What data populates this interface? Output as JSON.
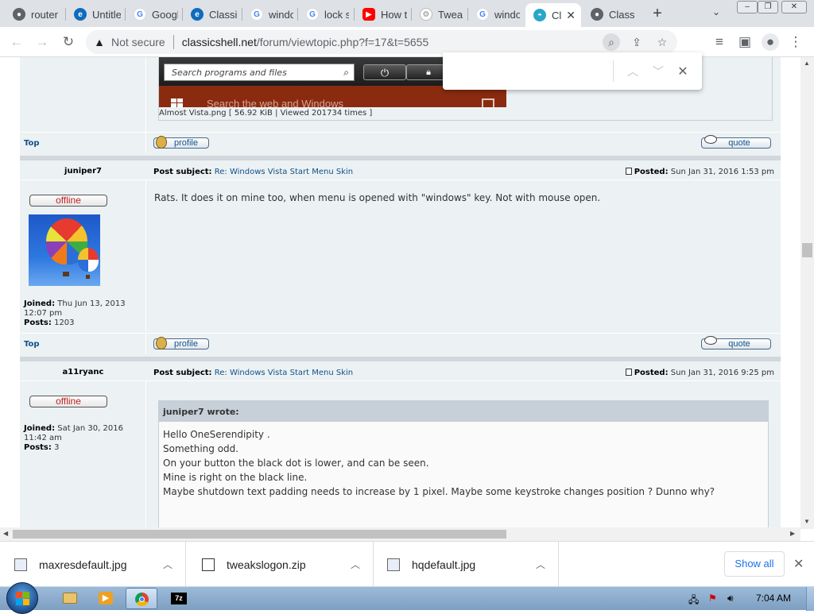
{
  "tabs": [
    {
      "label": "router",
      "favicon": "chrome-icon"
    },
    {
      "label": "Untitle",
      "favicon": "edge-icon"
    },
    {
      "label": "Googl",
      "favicon": "google-icon"
    },
    {
      "label": "Classi",
      "favicon": "edge-icon"
    },
    {
      "label": "windo",
      "favicon": "google-icon"
    },
    {
      "label": "lock s",
      "favicon": "google-icon"
    },
    {
      "label": "How t",
      "favicon": "youtube-icon"
    },
    {
      "label": "Tweak",
      "favicon": "gear-icon"
    },
    {
      "label": "windo",
      "favicon": "google-icon"
    },
    {
      "label": "Cl",
      "favicon": "classicshell-icon",
      "active": true
    },
    {
      "label": "Classi",
      "favicon": "chrome-icon"
    }
  ],
  "toolbar": {
    "not_secure": "Not secure",
    "url_domain": "classicshell.net",
    "url_path": "/forum/viewtopic.php?f=17&t=5655"
  },
  "attachment": {
    "search_placeholder": "Search programs and files",
    "bottom_text": "Search the web and Windows",
    "caption": "Almost Vista.png [ 56.92 KiB | Viewed 201734 times ]"
  },
  "buttons": {
    "top": "Top",
    "profile": "profile",
    "quote": "quote"
  },
  "posts": [
    {
      "author": "juniper7",
      "subject_label": "Post subject:",
      "subject": "Re: Windows Vista Start Menu Skin",
      "posted_label": "Posted:",
      "posted": "Sun Jan 31, 2016 1:53 pm",
      "status": "offline",
      "joined_label": "Joined:",
      "joined": "Thu Jun 13, 2013 12:07 pm",
      "posts_label": "Posts:",
      "posts": "1203",
      "body": "Rats. It does it on mine too, when menu is opened with \"windows\" key. Not with mouse open."
    },
    {
      "author": "a11ryanc",
      "subject_label": "Post subject:",
      "subject": "Re: Windows Vista Start Menu Skin",
      "posted_label": "Posted:",
      "posted": "Sun Jan 31, 2016 9:25 pm",
      "status": "offline",
      "joined_label": "Joined:",
      "joined": "Sat Jan 30, 2016 11:42 am",
      "posts_label": "Posts:",
      "posts": "3",
      "quote_header": "juniper7 wrote:",
      "quote_lines": [
        "Hello OneSerendipity .",
        "Something odd.",
        "On your button the black dot is lower, and can be seen.",
        "Mine is right on the black line.",
        "Maybe shutdown text padding needs to increase by 1 pixel. Maybe some keystroke changes position ? Dunno why?"
      ]
    }
  ],
  "downloads": [
    {
      "name": "maxresdefault.jpg",
      "icon": "image-file-icon"
    },
    {
      "name": "tweakslogon.zip",
      "icon": "zip-file-icon"
    },
    {
      "name": "hqdefault.jpg",
      "icon": "image-file-icon"
    }
  ],
  "shelf": {
    "show_all": "Show all"
  },
  "taskbar": {
    "time": "7:04 AM"
  },
  "colors": {
    "link": "#105289",
    "forum_bg": "#ecf1f3",
    "offline_text": "#c02020",
    "vista_red": "#8a2b10"
  }
}
